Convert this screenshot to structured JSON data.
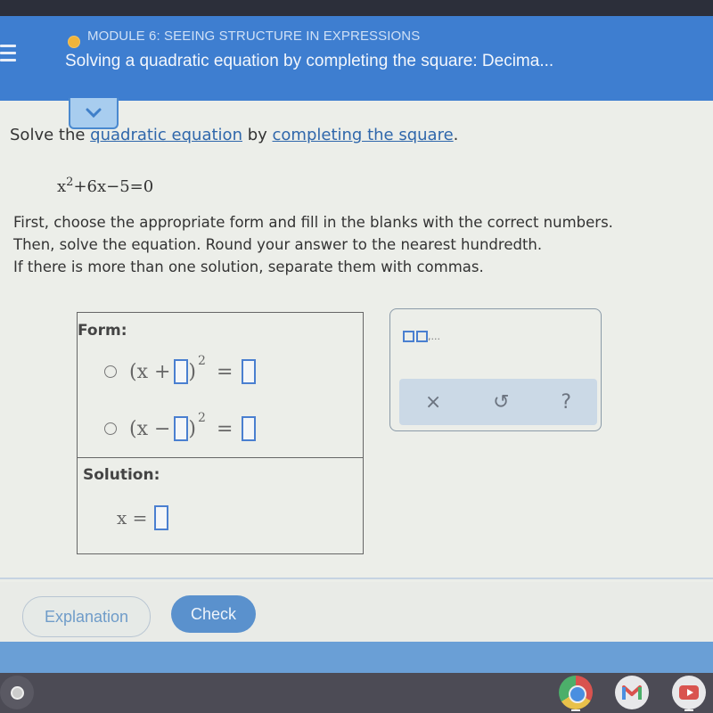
{
  "header": {
    "module_label": "MODULE 6: SEEING STRUCTURE IN EXPRESSIONS",
    "title": "Solving a quadratic equation by completing the square: Decima...",
    "status_dot_color": "#f0b43a",
    "menu_icon": "hamburger-menu-icon",
    "collapse_icon": "chevron-down-icon"
  },
  "problem": {
    "prompt_prefix": "Solve the ",
    "link_1": "quadratic equation",
    "prompt_mid": " by ",
    "link_2": "completing the square",
    "prompt_suffix": ".",
    "equation_base": "x",
    "equation_exponent": "2",
    "equation_rest": "+6x−5=0",
    "instructions": [
      "First, choose the appropriate form and fill in the blanks with the correct numbers.",
      "Then, solve the equation. Round your answer to the nearest hundredth.",
      "If there is more than one solution, separate them with commas."
    ]
  },
  "form_panel": {
    "form_label": "Form:",
    "options": [
      {
        "open": "(x +",
        "close": ")",
        "exponent": "2",
        "equals": "=",
        "selected": false
      },
      {
        "open": "(x −",
        "close": ")",
        "exponent": "2",
        "equals": "=",
        "selected": false
      }
    ],
    "solution_label": "Solution:",
    "solution_prefix": "x ="
  },
  "keypad": {
    "template_label": ",...",
    "actions": [
      {
        "name": "clear",
        "glyph": "×"
      },
      {
        "name": "undo",
        "glyph": "↺"
      },
      {
        "name": "help",
        "glyph": "?"
      }
    ]
  },
  "footer": {
    "explanation_label": "Explanation",
    "check_label": "Check"
  },
  "shelf": {
    "apps": [
      "chrome",
      "gmail",
      "youtube"
    ]
  }
}
